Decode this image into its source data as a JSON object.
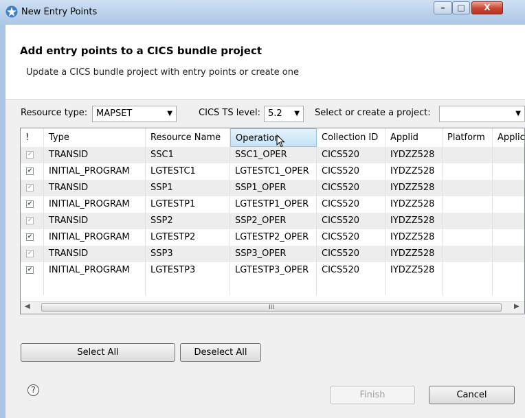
{
  "window": {
    "title": "New Entry Points",
    "minimize": "–",
    "maximize": "□",
    "close": "X"
  },
  "header": {
    "title": "Add entry points to a CICS bundle project",
    "subtitle": "Update a CICS bundle project with entry points or create one"
  },
  "filters": {
    "resource_type_label": "Resource type:",
    "resource_type_value": "MAPSET",
    "cics_ts_label": "CICS TS level:",
    "cics_ts_value": "5.2",
    "project_label": "Select or create a project:",
    "project_value": ""
  },
  "table": {
    "columns": [
      "!",
      "Type",
      "Resource Name",
      "Operation",
      "Collection ID",
      "Applid",
      "Platform",
      "Applic"
    ],
    "rows": [
      {
        "checked": true,
        "dim": true,
        "type": "TRANSID",
        "resource": "SSC1",
        "operation": "SSC1_OPER",
        "collection": "CICS520",
        "applid": "IYDZZ528",
        "platform": "",
        "applic": ""
      },
      {
        "checked": true,
        "dim": false,
        "type": "INITIAL_PROGRAM",
        "resource": "LGTESTC1",
        "operation": "LGTESTC1_OPER",
        "collection": "CICS520",
        "applid": "IYDZZ528",
        "platform": "",
        "applic": ""
      },
      {
        "checked": true,
        "dim": true,
        "type": "TRANSID",
        "resource": "SSP1",
        "operation": "SSP1_OPER",
        "collection": "CICS520",
        "applid": "IYDZZ528",
        "platform": "",
        "applic": ""
      },
      {
        "checked": true,
        "dim": false,
        "type": "INITIAL_PROGRAM",
        "resource": "LGTESTP1",
        "operation": "LGTESTP1_OPER",
        "collection": "CICS520",
        "applid": "IYDZZ528",
        "platform": "",
        "applic": ""
      },
      {
        "checked": true,
        "dim": true,
        "type": "TRANSID",
        "resource": "SSP2",
        "operation": "SSP2_OPER",
        "collection": "CICS520",
        "applid": "IYDZZ528",
        "platform": "",
        "applic": ""
      },
      {
        "checked": true,
        "dim": false,
        "type": "INITIAL_PROGRAM",
        "resource": "LGTESTP2",
        "operation": "LGTESTP2_OPER",
        "collection": "CICS520",
        "applid": "IYDZZ528",
        "platform": "",
        "applic": ""
      },
      {
        "checked": true,
        "dim": true,
        "type": "TRANSID",
        "resource": "SSP3",
        "operation": "SSP3_OPER",
        "collection": "CICS520",
        "applid": "IYDZZ528",
        "platform": "",
        "applic": ""
      },
      {
        "checked": true,
        "dim": false,
        "type": "INITIAL_PROGRAM",
        "resource": "LGTESTP3",
        "operation": "LGTESTP3_OPER",
        "collection": "CICS520",
        "applid": "IYDZZ528",
        "platform": "",
        "applic": ""
      }
    ],
    "scroll_thumb_label": "III"
  },
  "buttons": {
    "select_all": "Select All",
    "deselect_all": "Deselect All",
    "finish": "Finish",
    "cancel": "Cancel",
    "help": "?"
  },
  "icons": {
    "title": "star-icon",
    "help": "help-icon"
  }
}
